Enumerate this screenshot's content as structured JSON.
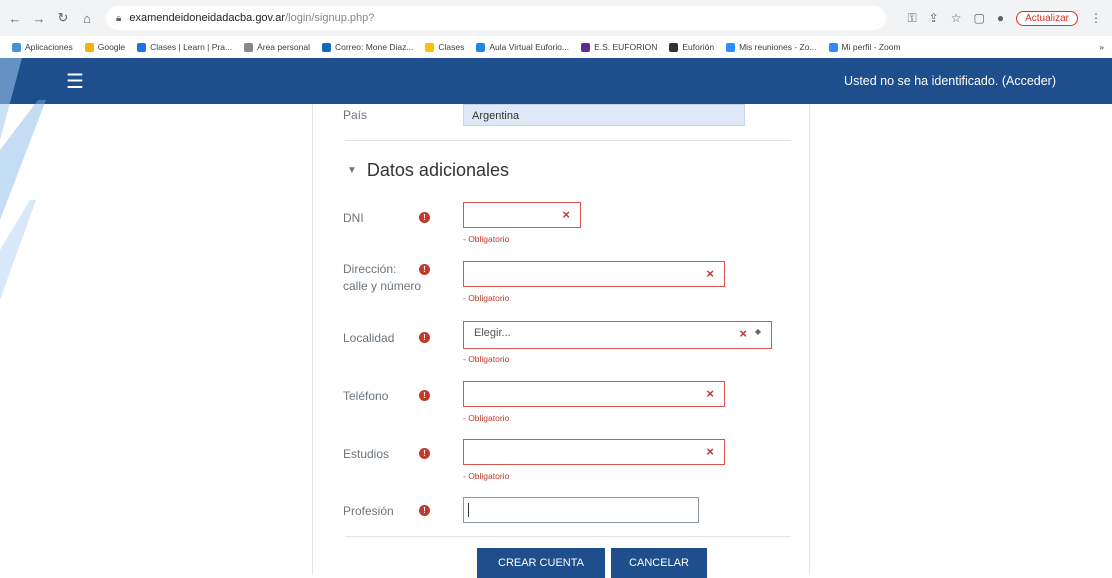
{
  "browser": {
    "url_domain": "examendeidoneidadacba.gov.ar",
    "url_path": "/login/signup.php?",
    "update_label": "Actualizar"
  },
  "bookmarks": [
    {
      "label": "Aplicaciones",
      "color": "#4a90d9"
    },
    {
      "label": "Google",
      "color": "#f4b400"
    },
    {
      "label": "Clases | Learn | Pra...",
      "color": "#1a73e8"
    },
    {
      "label": "Área personal",
      "color": "#888888"
    },
    {
      "label": "Correo: Mone Diaz...",
      "color": "#0f6cbd"
    },
    {
      "label": "Clases",
      "color": "#ffbf00"
    },
    {
      "label": "Aula Virtual Euforio...",
      "color": "#1e88e5"
    },
    {
      "label": "E.S. EUFORION",
      "color": "#5b2d91"
    },
    {
      "label": "Euforión",
      "color": "#333333"
    },
    {
      "label": "Mis reuniones - Zo...",
      "color": "#2d8cff"
    },
    {
      "label": "Mi perfil - Zoom",
      "color": "#2d8cff"
    }
  ],
  "header": {
    "login_text": "Usted no se ha identificado.",
    "login_link": "(Acceder)"
  },
  "form": {
    "pais_label": "País",
    "pais_value": "Argentina",
    "section_title": "Datos adicionales",
    "required_text": "- Obligatorio",
    "fields": {
      "dni": {
        "label": "DNI"
      },
      "direccion": {
        "label_line1": "Dirección:",
        "label_line2": "calle y número"
      },
      "localidad": {
        "label": "Localidad",
        "placeholder": "Elegir..."
      },
      "telefono": {
        "label": "Teléfono"
      },
      "estudios": {
        "label": "Estudios"
      },
      "profesion": {
        "label": "Profesión"
      }
    },
    "create_button": "CREAR CUENTA",
    "cancel_button": "CANCELAR"
  },
  "colors": {
    "header_blue": "#1f4e8c",
    "error_red": "#c0392b"
  }
}
